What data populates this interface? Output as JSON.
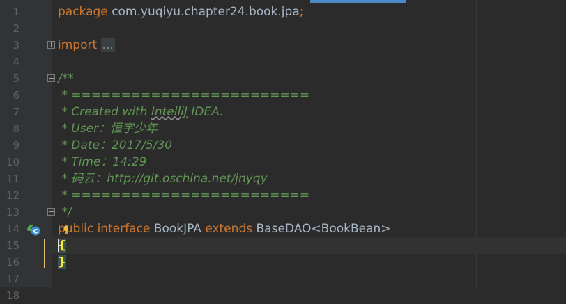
{
  "editor": {
    "line_numbers": [
      "1",
      "2",
      "3",
      "4",
      "5",
      "6",
      "7",
      "8",
      "9",
      "10",
      "11",
      "12",
      "13",
      "14",
      "15",
      "16",
      "17",
      "18"
    ],
    "line1": {
      "keyword": "package",
      "name": "com.yuqiyu.chapter24.book.jpa",
      "semicolon": ";"
    },
    "line3": {
      "keyword": "import",
      "folded": "..."
    },
    "line6": "/**",
    "line7": " * ========================",
    "line8": {
      "prefix": " * Created with ",
      "word": "IntelliJ",
      "suffix": " IDEA."
    },
    "line9": " * User：恒宇少年",
    "line10": " * Date：2017/5/30",
    "line11": " * Time：14:29",
    "line12": " * 码云：http://git.oschina.net/jnyqy",
    "line13": " * ========================",
    "line14": " */",
    "line15": {
      "kw_public": "public",
      "kw_interface": "interface",
      "class_name": "BookJPA",
      "kw_extends": "extends",
      "super_type": "BaseDAO<BookBean>"
    },
    "line16": "{",
    "line17": "}",
    "colors": {
      "background": "#2b2b2b",
      "keyword": "#cc7832",
      "comment": "#629755",
      "identifier": "#a9b7c6",
      "line_number": "#606366",
      "brace": "#e8bf6a"
    },
    "icons": [
      "fold-expand-icon",
      "fold-collapse-icon",
      "implemented-interface-icon",
      "intention-bulb-icon"
    ]
  }
}
